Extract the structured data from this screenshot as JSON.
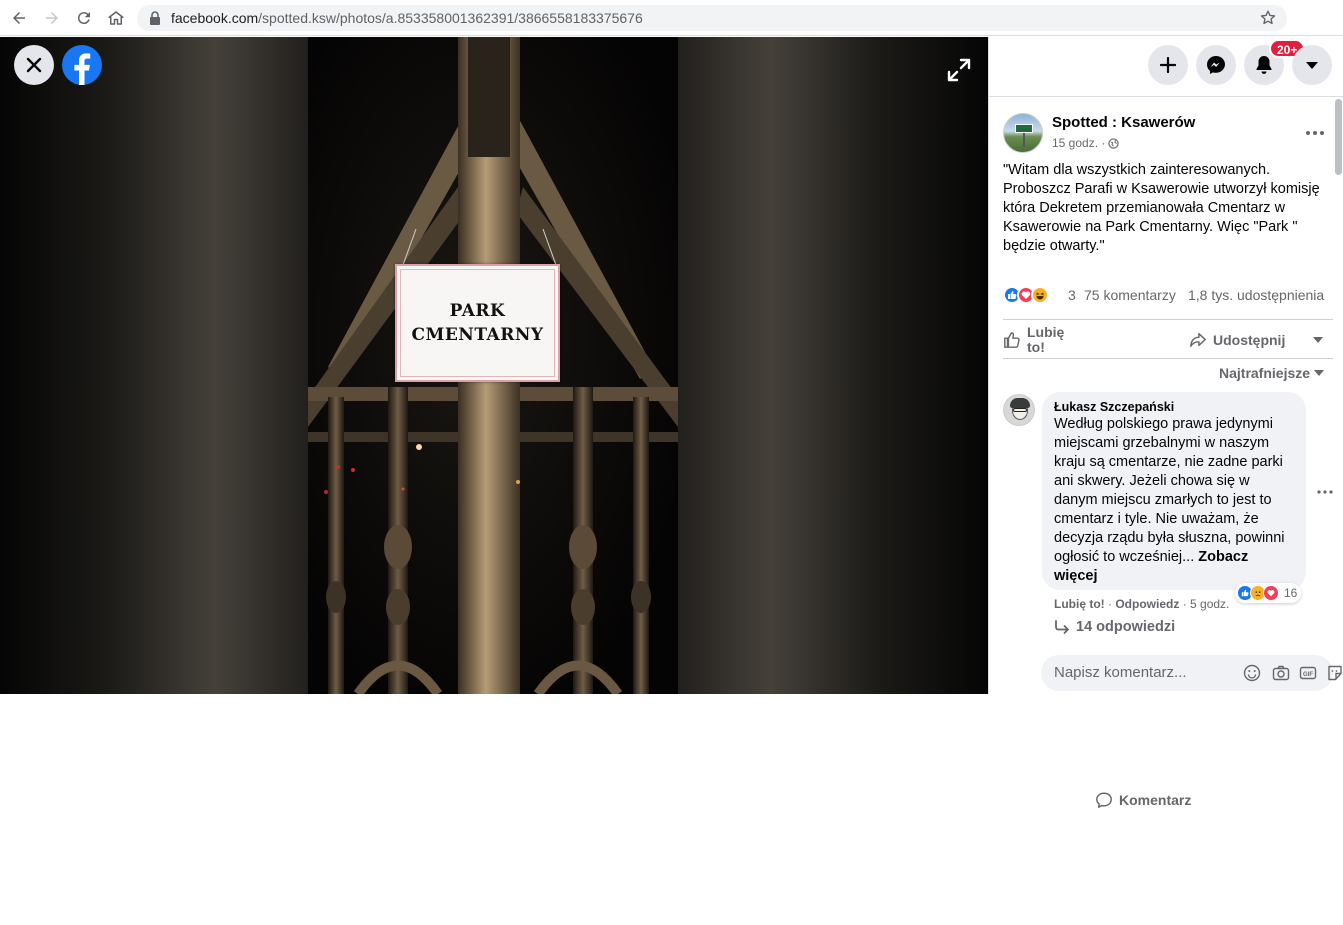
{
  "browser": {
    "url_main": "facebook.com",
    "url_rest": "/spotted.ksw/photos/a.853358001362391/3866558183375676"
  },
  "photo": {
    "sign_line1": "PARK",
    "sign_line2": "CMENTARNY"
  },
  "topbar": {
    "notifications_badge": "20+"
  },
  "post": {
    "page_name": "Spotted : Ksawerów",
    "time": "15 godz. ·",
    "text": "\"Witam dla wszystkich zainteresowanych. Proboszcz Parafi w Ksawerowie utworzył komisję która Dekretem przemianowała Cmentarz w Ksawerowie na Park Cmentarny. Więc \"Park \" będzie otwarty.\"",
    "reactions_count": "3",
    "comments_count": "75 komentarzy",
    "shares_count": "1,8 tys. udostępnienia",
    "reactions": [
      "like",
      "love",
      "haha"
    ]
  },
  "actions": {
    "like": "Lubię to!",
    "comment": "Komentarz",
    "share": "Udostępnij"
  },
  "sort_label": "Najtrafniejsze",
  "comment": {
    "author": "Łukasz Szczepański",
    "text": "Według polskiego prawa jedynymi miejscami grzebalnymi w naszym kraju są cmentarze, nie zadne parki ani skwery. Jeżeli chowa się w danym miejscu zmarłych to jest to cmentarz i tyle. Nie uważam, że decyzja rządu była słuszna, powinni ogłosić to wcześniej...",
    "see_more": "Zobacz więcej",
    "reactions_count": "16",
    "like": "Lubię to!",
    "reply": "Odpowiedz",
    "time": "5 godz.",
    "replies": "14 odpowiedzi"
  },
  "composer": {
    "placeholder": "Napisz komentarz..."
  },
  "colors": {
    "accent": "#1877f2",
    "badge": "#e41e3f",
    "love": "#f33e58",
    "haha": "#f7b125"
  }
}
